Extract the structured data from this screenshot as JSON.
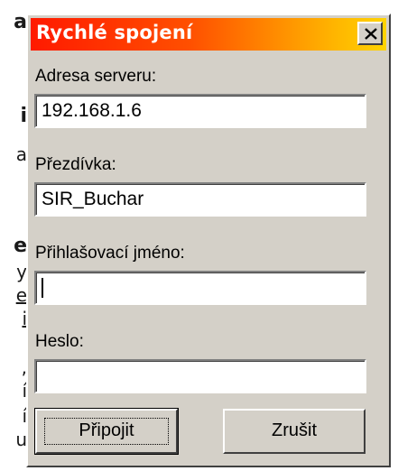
{
  "background": {
    "fragments": [
      "a",
      "i",
      "a",
      "e",
      "y",
      "e",
      "i",
      ",",
      "í",
      "í",
      "u"
    ]
  },
  "dialog": {
    "title": "Rychlé spojení",
    "fields": {
      "server": {
        "label": "Adresa serveru:",
        "value": "192.168.1.6"
      },
      "nick": {
        "label": "Přezdívka:",
        "value": "SIR_Buchar"
      },
      "login": {
        "label": "Přihlašovací jméno:",
        "value": ""
      },
      "password": {
        "label": "Heslo:",
        "value": ""
      }
    },
    "buttons": {
      "connect": "Připojit",
      "cancel": "Zrušit"
    }
  },
  "colors": {
    "titlebar_start": "#ff1a00",
    "titlebar_end": "#ffd400",
    "face": "#d4d0c8"
  }
}
